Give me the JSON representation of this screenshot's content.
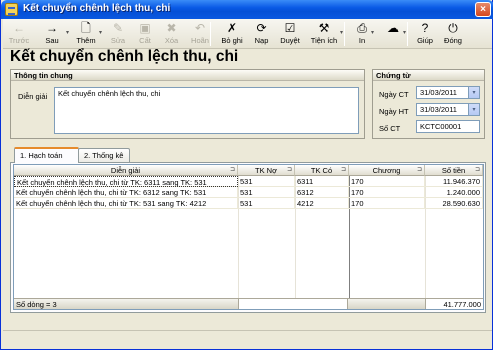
{
  "window": {
    "title": "Kết chuyển chênh lệch thu, chi",
    "close_glyph": "×"
  },
  "toolbar": {
    "items": [
      {
        "label": "Trước",
        "icon": "arrow-left-icon",
        "glyph": "←",
        "enabled": false
      },
      {
        "label": "Sau",
        "icon": "arrow-right-icon",
        "glyph": "→",
        "enabled": true
      },
      {
        "label": "Thêm",
        "icon": "add-document-icon",
        "glyph": "🗋",
        "enabled": true
      },
      {
        "label": "Sửa",
        "icon": "edit-icon",
        "glyph": "✎",
        "enabled": false
      },
      {
        "label": "Cất",
        "icon": "save-icon",
        "glyph": "▣",
        "enabled": false
      },
      {
        "label": "Xóa",
        "icon": "delete-icon",
        "glyph": "✖",
        "enabled": false
      },
      {
        "label": "Hoãn",
        "icon": "undo-icon",
        "glyph": "↶",
        "enabled": false
      },
      {
        "label": "Bỏ ghi",
        "icon": "unpost-icon",
        "glyph": "✗",
        "enabled": true
      },
      {
        "label": "Nạp",
        "icon": "reload-icon",
        "glyph": "⟳",
        "enabled": true
      },
      {
        "label": "Duyệt",
        "icon": "approve-icon",
        "glyph": "☑",
        "enabled": true
      },
      {
        "label": "Tiện ích",
        "icon": "utilities-icon",
        "glyph": "⚒",
        "enabled": true
      },
      {
        "label": "In",
        "icon": "print-icon",
        "glyph": "⎙",
        "enabled": true
      },
      {
        "label": "",
        "icon": "cloud-icon",
        "glyph": "☁",
        "enabled": true
      },
      {
        "label": "Giúp",
        "icon": "help-icon",
        "glyph": "?",
        "enabled": true
      },
      {
        "label": "Đóng",
        "icon": "close-window-icon",
        "glyph": "⏻",
        "enabled": true
      }
    ],
    "dropdown_glyph": "▾"
  },
  "page_title": "Kết chuyển chênh lệch thu, chi",
  "general_info": {
    "header": "Thông tin chung",
    "description_label": "Diễn giải",
    "description_value": "Kết chuyển chênh lệch thu, chi"
  },
  "voucher": {
    "header": "Chứng từ",
    "voucher_date_label": "Ngày CT",
    "voucher_date": "31/03/2011",
    "posting_date_label": "Ngày HT",
    "posting_date": "31/03/2011",
    "voucher_no_label": "Số CT",
    "voucher_no": "KCTC00001",
    "dropdown_glyph": "▾"
  },
  "tabs": [
    {
      "label": "1. Hạch toán",
      "active": true
    },
    {
      "label": "2. Thống kê",
      "active": false
    }
  ],
  "grid": {
    "pin_glyph": "⊐",
    "columns": [
      "Diễn giải",
      "TK Nợ",
      "TK Có",
      "Chương",
      "Số tiền"
    ],
    "rows": [
      [
        "Kết chuyển chênh lệch thu, chi từ TK: 6311 sang TK: 531",
        "531",
        "6311",
        "170",
        "11.946.370"
      ],
      [
        "Kết chuyển chênh lệch thu, chi từ TK: 6312 sang TK: 531",
        "531",
        "6312",
        "170",
        "1.240.000"
      ],
      [
        "Kết chuyển chênh lệch thu, chi từ TK: 531 sang TK: 4212",
        "531",
        "4212",
        "170",
        "28.590.630"
      ]
    ],
    "row_count_text": "Số dòng = 3",
    "total": "41.777.000"
  }
}
